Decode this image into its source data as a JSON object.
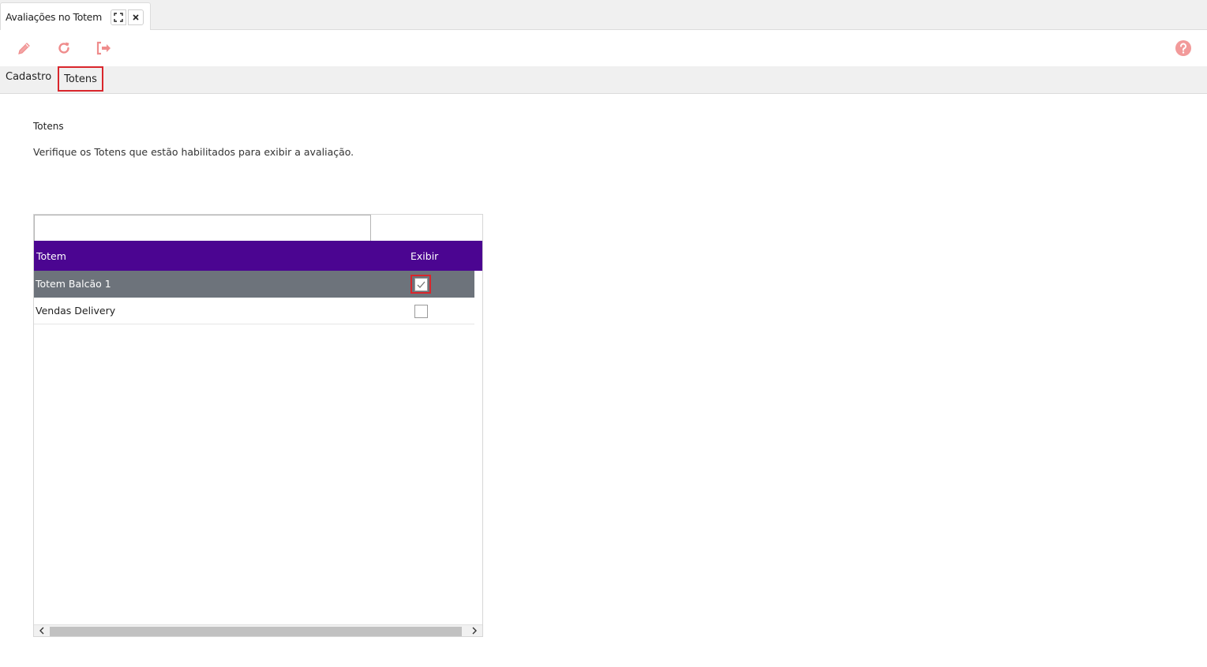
{
  "window_tab": {
    "title": "Avaliações no Totem",
    "expand_icon": "expand-icon",
    "close_icon": "close-icon"
  },
  "toolbar": {
    "icons": [
      "pencil-icon",
      "refresh-icon",
      "exit-icon",
      "help-icon"
    ],
    "icon_color": "#f08a8a"
  },
  "subtabs": [
    {
      "label": "Cadastro",
      "active": false
    },
    {
      "label": "Totens",
      "active": true
    }
  ],
  "section": {
    "title": "Totens",
    "description": "Verifique os Totens que estão habilitados para exibir a avaliação."
  },
  "grid": {
    "filter_value": "",
    "columns": [
      "Totem",
      "Exibir"
    ],
    "header_color": "#4b0591",
    "rows": [
      {
        "totem": "Totem Balcão 1",
        "exibir": true,
        "selected": true
      },
      {
        "totem": "Vendas Delivery",
        "exibir": false,
        "selected": false
      }
    ]
  },
  "highlight_color": "#d9262c"
}
